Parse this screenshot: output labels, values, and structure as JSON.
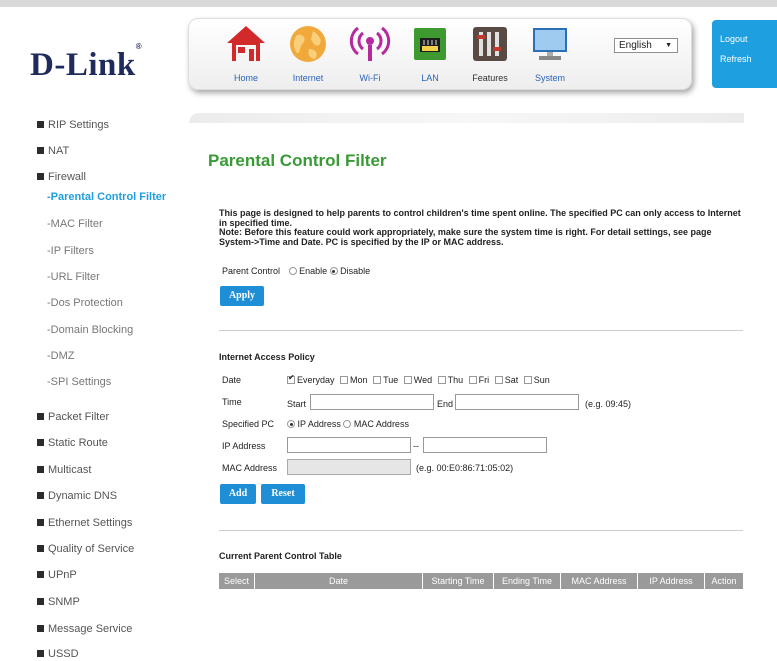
{
  "brand": {
    "name": "D-Link",
    "mark": "®"
  },
  "nav": [
    {
      "label": "Home",
      "icon": "home-icon"
    },
    {
      "label": "Internet",
      "icon": "globe-icon"
    },
    {
      "label": "Wi-Fi",
      "icon": "wifi-icon"
    },
    {
      "label": "LAN",
      "icon": "lan-icon"
    },
    {
      "label": "Features",
      "icon": "tools-icon"
    },
    {
      "label": "System",
      "icon": "monitor-icon"
    }
  ],
  "language": {
    "selected": "English"
  },
  "account": {
    "logout": "Logout",
    "refresh": "Refresh"
  },
  "sidebar": [
    {
      "label": "RIP Settings"
    },
    {
      "label": "NAT"
    },
    {
      "label": "Firewall"
    },
    {
      "label": "-Parental Control Filter"
    },
    {
      "label": "-MAC Filter"
    },
    {
      "label": "-IP Filters"
    },
    {
      "label": "-URL Filter"
    },
    {
      "label": "-Dos Protection"
    },
    {
      "label": "-Domain Blocking"
    },
    {
      "label": "-DMZ"
    },
    {
      "label": "-SPI Settings"
    },
    {
      "label": "Packet Filter"
    },
    {
      "label": "Static Route"
    },
    {
      "label": "Multicast"
    },
    {
      "label": "Dynamic DNS"
    },
    {
      "label": "Ethernet Settings"
    },
    {
      "label": "Quality of Service"
    },
    {
      "label": "UPnP"
    },
    {
      "label": "SNMP"
    },
    {
      "label": "Message Service"
    },
    {
      "label": "USSD"
    }
  ],
  "page": {
    "title": "Parental Control Filter",
    "description_1": "This page is designed to help parents to control children's time spent online. The specified PC can only access to Internet in specified time.",
    "description_2": "Note: Before this feature could work appropriately, make sure the system time is right. For detail settings, see page System->Time and Date. PC is specified by the IP or MAC address."
  },
  "parent_control": {
    "label": "Parent Control",
    "enable": "Enable",
    "disable": "Disable",
    "selected": "Disable",
    "apply": "Apply"
  },
  "policy": {
    "title": "Internet Access Policy",
    "date_label": "Date",
    "days": [
      {
        "label": "Everyday",
        "checked": true
      },
      {
        "label": "Mon",
        "checked": false
      },
      {
        "label": "Tue",
        "checked": false
      },
      {
        "label": "Wed",
        "checked": false
      },
      {
        "label": "Thu",
        "checked": false
      },
      {
        "label": "Fri",
        "checked": false
      },
      {
        "label": "Sat",
        "checked": false
      },
      {
        "label": "Sun",
        "checked": false
      }
    ],
    "time_label": "Time",
    "start_label": "Start",
    "end_label": "End",
    "time_hint": "(e.g. 09:45)",
    "start_value": "",
    "end_value": "",
    "specified_label": "Specified PC",
    "ip_option": "IP Address",
    "mac_option": "MAC Address",
    "specified_selected": "IP Address",
    "ip_label": "IP Address",
    "ip_sep": "--",
    "ip_start": "",
    "ip_end": "",
    "mac_label": "MAC Address",
    "mac_value": "",
    "mac_hint": "(e.g. 00:E0:86:71:05:02)",
    "add": "Add",
    "reset": "Reset"
  },
  "table": {
    "title": "Current Parent Control Table",
    "columns": [
      "Select",
      "Date",
      "Starting Time",
      "Ending Time",
      "MAC Address",
      "IP Address",
      "Action"
    ],
    "rows": []
  },
  "colors": {
    "accent": "#1e9fe0",
    "title": "#3a9a36",
    "button": "#1e8fd6",
    "table_header": "#9a9a9a"
  }
}
